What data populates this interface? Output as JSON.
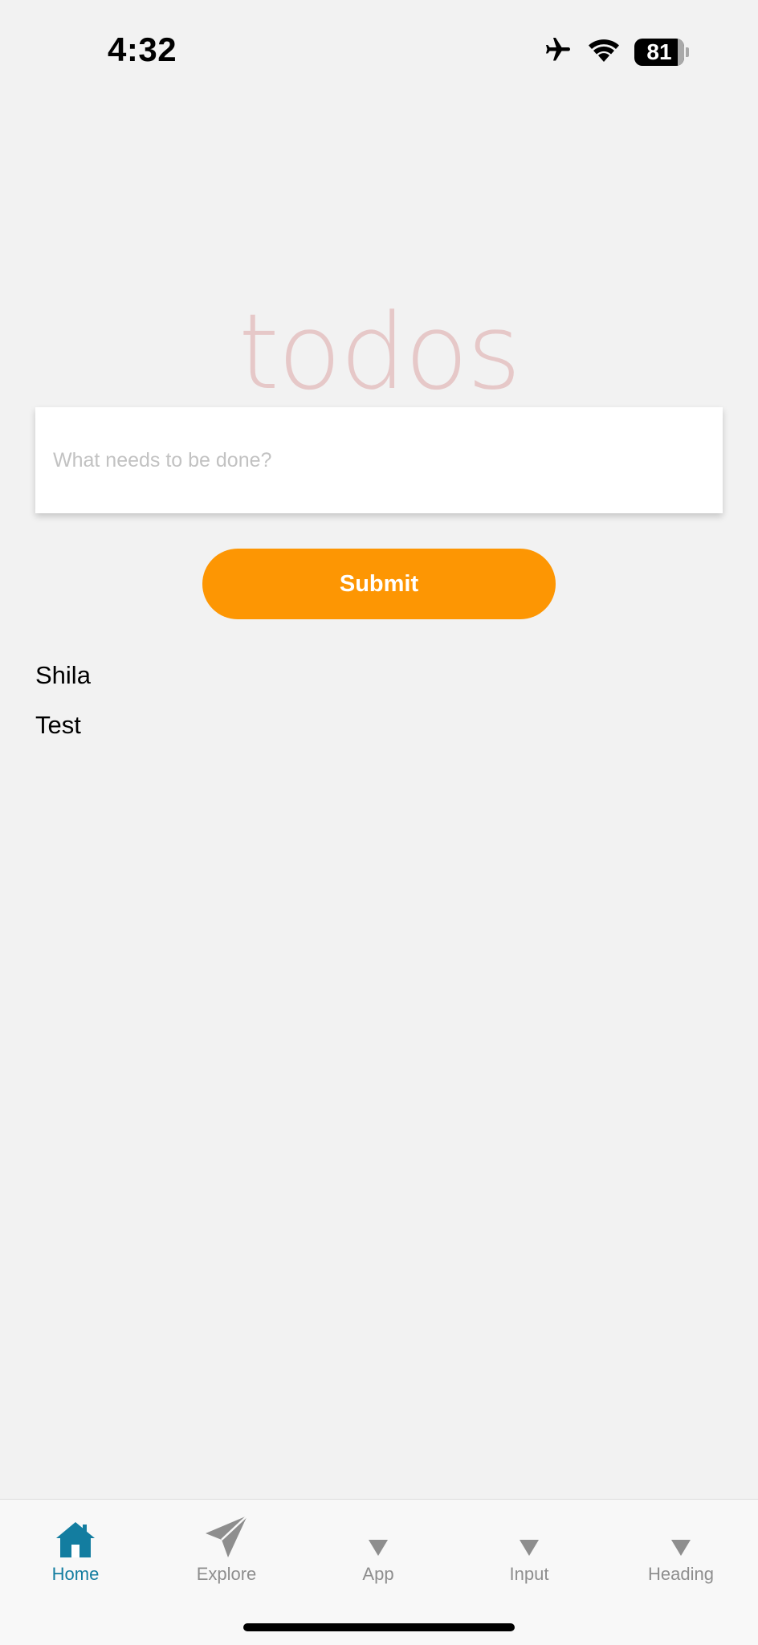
{
  "status_bar": {
    "time": "4:32",
    "battery_level": "81",
    "icons": [
      "airplane-icon",
      "wifi-icon",
      "battery-icon"
    ]
  },
  "app": {
    "title": "todos",
    "new_todo_placeholder": "What needs to be done?",
    "new_todo_value": "",
    "submit_label": "Submit"
  },
  "todos": [
    {
      "label": "Shila"
    },
    {
      "label": "Test"
    }
  ],
  "tab_bar": {
    "active_tab": "Home",
    "tabs": [
      {
        "label": "Home",
        "icon": "home-icon"
      },
      {
        "label": "Explore",
        "icon": "paper-plane-icon"
      },
      {
        "label": "App",
        "icon": "triangle-down-icon"
      },
      {
        "label": "Input",
        "icon": "triangle-down-icon"
      },
      {
        "label": "Heading",
        "icon": "triangle-down-icon"
      }
    ]
  },
  "colors": {
    "accent": "#fd9603",
    "active_tab": "#137da0",
    "inactive_tab": "#8e8e8e",
    "title": "#e6c8c8",
    "background": "#f2f2f2"
  }
}
